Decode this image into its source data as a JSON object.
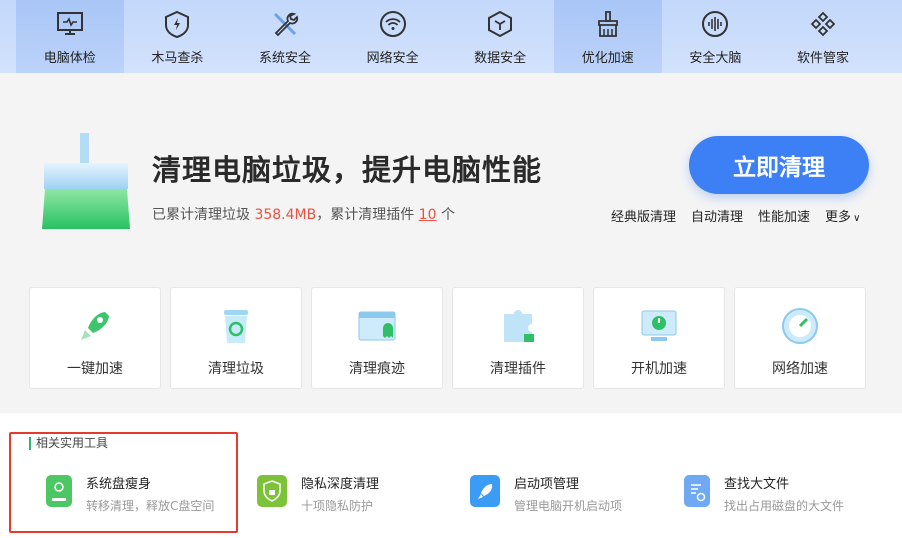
{
  "nav": [
    {
      "label": "电脑体检",
      "icon": "monitor-icon",
      "active": true
    },
    {
      "label": "木马查杀",
      "icon": "shield-bolt-icon"
    },
    {
      "label": "系统安全",
      "icon": "wrench-icon"
    },
    {
      "label": "网络安全",
      "icon": "wifi-icon"
    },
    {
      "label": "数据安全",
      "icon": "cube-icon"
    },
    {
      "label": "优化加速",
      "icon": "broom-icon",
      "active": true
    },
    {
      "label": "安全大脑",
      "icon": "brain-icon"
    },
    {
      "label": "软件管家",
      "icon": "apps-icon"
    }
  ],
  "hero": {
    "title": "清理电脑垃圾，提升电脑性能",
    "sub_prefix": "已累计清理垃圾 ",
    "junk_size": "358.4MB",
    "sub_mid": "，累计清理插件 ",
    "plugin_count": "10",
    "sub_suffix": " 个",
    "button": "立即清理",
    "links": [
      "经典版清理",
      "自动清理",
      "性能加速",
      "更多"
    ]
  },
  "cards": [
    {
      "label": "一键加速",
      "icon": "rocket-icon"
    },
    {
      "label": "清理垃圾",
      "icon": "recycle-bin-icon"
    },
    {
      "label": "清理痕迹",
      "icon": "window-ghost-icon"
    },
    {
      "label": "清理插件",
      "icon": "puzzle-icon"
    },
    {
      "label": "开机加速",
      "icon": "power-monitor-icon"
    },
    {
      "label": "网络加速",
      "icon": "speedometer-icon"
    }
  ],
  "tools": {
    "section": "相关实用工具",
    "items": [
      {
        "name": "系统盘瘦身",
        "desc": "转移清理，释放C盘空间",
        "color": "#4cc764"
      },
      {
        "name": "隐私深度清理",
        "desc": "十项隐私防护",
        "color": "#7cc33a"
      },
      {
        "name": "启动项管理",
        "desc": "管理电脑开机启动项",
        "color": "#3a9cf5"
      },
      {
        "name": "查找大文件",
        "desc": "找出占用磁盘的大文件",
        "color": "#6fa9f4"
      }
    ]
  }
}
